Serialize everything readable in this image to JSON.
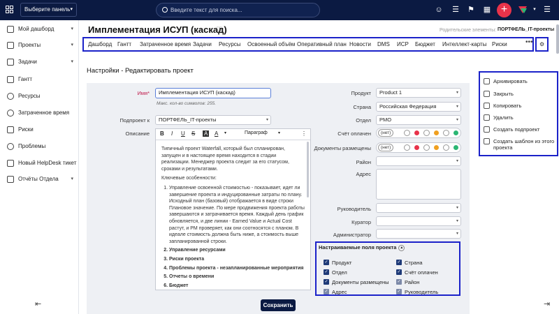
{
  "topbar": {
    "panel_select": "Выберите панель",
    "search_placeholder": "Введите текст для поиска...",
    "colors": {
      "bg": "#0b1a42",
      "accent": "#e8334a"
    }
  },
  "sidebar": {
    "items": [
      {
        "label": "Мой дашборд",
        "icon": "dashboard-icon",
        "has_chevron": true
      },
      {
        "label": "Проекты",
        "icon": "projects-icon",
        "has_chevron": true
      },
      {
        "label": "Задачи",
        "icon": "tasks-icon",
        "has_chevron": true
      },
      {
        "label": "Гантт",
        "icon": "gantt-icon",
        "has_chevron": false
      },
      {
        "label": "Ресурсы",
        "icon": "resources-icon",
        "has_chevron": false
      },
      {
        "label": "Затраченное время",
        "icon": "clock-icon",
        "has_chevron": false
      },
      {
        "label": "Риски",
        "icon": "risks-icon",
        "has_chevron": false
      },
      {
        "label": "Проблемы",
        "icon": "problems-icon",
        "has_chevron": false
      },
      {
        "label": "Новый HelpDesk тикет",
        "icon": "helpdesk-icon",
        "has_chevron": false
      },
      {
        "label": "Отчёты Отдела",
        "icon": "reports-icon",
        "has_chevron": true
      }
    ]
  },
  "header": {
    "title": "Имплементация ИСУП (каскад)",
    "parent_label": "Родительские элементы:",
    "parent_value": "ПОРТФЕЛЬ_IT-проекты"
  },
  "tabs": [
    "Дашборд",
    "Гантт",
    "Затраченное время",
    "Задачи",
    "Ресурсы",
    "Освоенный объём",
    "Оперативный план",
    "Новости",
    "DMS",
    "ИСР",
    "Бюджет",
    "Интеллект-карты",
    "Риски"
  ],
  "section_title": "Настройки - Редактировать проект",
  "form": {
    "name_label": "Имя*",
    "name_value": "Имплементация ИСУП (каскад)",
    "name_hint": "Макс. кол-во символов: 255.",
    "subproject_label": "Подпроект к",
    "subproject_value": "ПОРТФЕЛЬ_IT-проекты",
    "description_label": "Описание",
    "paragraph_style": "Параграф",
    "description_intro": "Типичный проект Waterfall, который был спланирован, запущен и в настоящее время находится в стадии реализации. Менеджер проекта следит за его статусом, сроками и результатами.",
    "features_title": "Ключевые особенности:",
    "features": [
      {
        "text": "Управление освоенной стоимостью - показывает, идет ли завершение проекта и индуцированные затраты по плану. Исходный план (базовый) отображается в виде строки Плановое значение. По мере продвижения проекта работы завершаются и затрачивается время. Каждый день график обновляется, и две линии - Earned Value и Actual Cost растут, и PM проверяет, как они соотносятся с планом. В идеале стоимость должна быть ниже, а стоимость выше запланированной строки.",
        "bold": false
      },
      {
        "text": "Управление ресурсами",
        "bold": true
      },
      {
        "text": "Риски проекта",
        "bold": true
      },
      {
        "text": "Проблемы проекта - незапланированные мероприятия",
        "bold": true
      },
      {
        "text": "Отчеты о времени",
        "bold": true
      },
      {
        "text": "Бюджет",
        "bold": true
      }
    ],
    "product_label": "Продукт",
    "product_value": "Product 1",
    "country_label": "Страна",
    "country_value": "Российская Федерация",
    "department_label": "Отдел",
    "department_value": "PMO",
    "invoice_paid_label": "Счёт оплачен",
    "docs_placed_label": "Документы размещены",
    "none_option": "(нет)",
    "district_label": "Район",
    "address_label": "Адрес",
    "manager_label": "Руководитель",
    "curator_label": "Куратор",
    "admin_label": "Администратор",
    "status_colors": [
      "#e8334a",
      "#f0a020",
      "#2bb673"
    ]
  },
  "custom_fields": {
    "title": "Настраиваемые поля проекта",
    "items": [
      {
        "label": "Продукт",
        "checked": true
      },
      {
        "label": "Страна",
        "checked": true
      },
      {
        "label": "Отдел",
        "checked": true
      },
      {
        "label": "Счёт оплачен",
        "checked": true
      },
      {
        "label": "Документы размещены",
        "checked": true
      },
      {
        "label": "Район",
        "checked": true
      },
      {
        "label": "Адрес",
        "checked": true
      },
      {
        "label": "Руководитель",
        "checked": true
      }
    ]
  },
  "save_button": "Сохранить",
  "dropdown": {
    "items": [
      {
        "label": "Архивировать",
        "icon": "archive-icon"
      },
      {
        "label": "Закрыть",
        "icon": "lock-icon"
      },
      {
        "label": "Копировать",
        "icon": "copy-icon"
      },
      {
        "label": "Удалить",
        "icon": "trash-icon"
      },
      {
        "label": "Создать подпроект",
        "icon": "add-subproject-icon"
      },
      {
        "label": "Создать шаблон из этого проекта",
        "icon": "template-icon"
      }
    ]
  }
}
